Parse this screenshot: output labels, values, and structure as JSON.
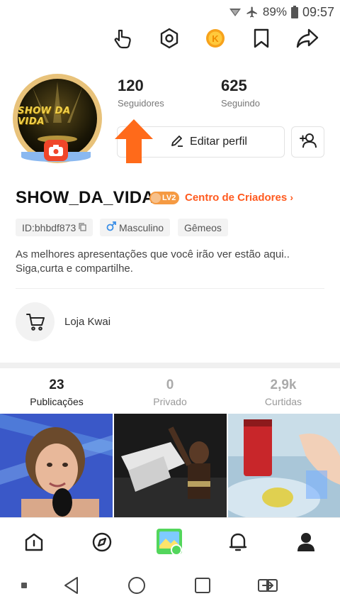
{
  "status_bar": {
    "battery": "89%",
    "time": "09:57",
    "icons": [
      "signal-icon",
      "airplane-icon",
      "battery-icon"
    ]
  },
  "top_bar": {
    "icons": [
      "hand-point-icon",
      "settings-hexagon-icon",
      "coin-icon",
      "bookmark-icon",
      "share-icon"
    ]
  },
  "profile": {
    "avatar_text": "SHOW DA VIDA",
    "followers": {
      "value": "120",
      "label": "Seguidores"
    },
    "following": {
      "value": "625",
      "label": "Seguindo"
    },
    "edit_label": "Editar perfil",
    "username": "SHOW_DA_VIDA",
    "level_badge": "LV2",
    "creators_link": "Centro de Criadores",
    "tags": {
      "id": "ID:bhbdf873",
      "gender": "Masculino",
      "sign": "Gêmeos"
    },
    "bio": "As melhores apresentações que você irão ver estão aqui.. Siga,curta e compartilhe.",
    "shop_label": "Loja Kwai"
  },
  "tabs": [
    {
      "num": "23",
      "label": "Publicações",
      "active": true
    },
    {
      "num": "0",
      "label": "Privado",
      "active": false
    },
    {
      "num": "2,9k",
      "label": "Curtidas",
      "active": false
    }
  ],
  "bottom_nav": [
    "home-icon",
    "discover-compass-icon",
    "create-gallery-icon",
    "notifications-bell-icon",
    "profile-person-icon"
  ],
  "system_nav": [
    "dot-icon",
    "back-icon",
    "home-circle-icon",
    "recents-icon",
    "switch-app-icon"
  ],
  "colors": {
    "accent": "#ff5a1f",
    "arrow": "#ff6a1a",
    "tab_active": "#222222",
    "tab_inactive": "#999999"
  }
}
